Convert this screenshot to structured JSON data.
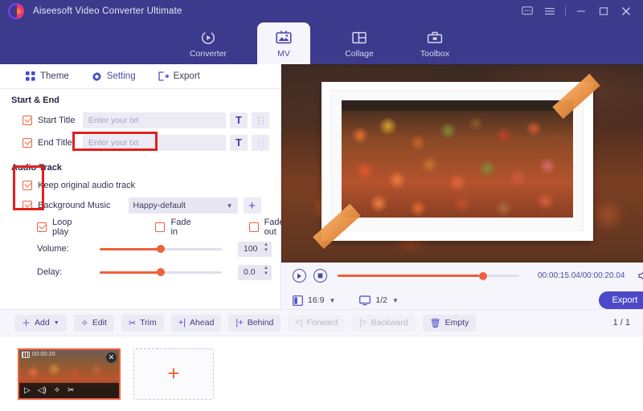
{
  "window": {
    "app_title": "Aiseesoft Video Converter Ultimate",
    "controls": [
      {
        "name": "feedback",
        "glyph": "chat-icon"
      },
      {
        "name": "menu",
        "glyph": "hamburger-icon"
      },
      {
        "name": "minimize",
        "glyph": "minimize-icon"
      },
      {
        "name": "maximize",
        "glyph": "maximize-icon"
      },
      {
        "name": "close",
        "glyph": "close-icon"
      }
    ]
  },
  "nav": {
    "items": [
      {
        "label": "Converter",
        "icon": "converter-icon",
        "active": false
      },
      {
        "label": "MV",
        "icon": "mv-icon",
        "active": true
      },
      {
        "label": "Collage",
        "icon": "collage-icon",
        "active": false
      },
      {
        "label": "Toolbox",
        "icon": "toolbox-icon",
        "active": false
      }
    ]
  },
  "subtabs": {
    "items": [
      {
        "label": "Theme",
        "icon": "grid-icon",
        "active": false
      },
      {
        "label": "Setting",
        "icon": "gear-icon",
        "active": true
      },
      {
        "label": "Export",
        "icon": "export-icon",
        "active": false
      }
    ]
  },
  "settings": {
    "start_end": {
      "section_label": "Start & End",
      "start_title": {
        "label": "Start Title",
        "checked": true,
        "value": "",
        "placeholder": "Enter your txt",
        "text_button": "T",
        "drag_button": "⣿"
      },
      "end_title": {
        "label": "End Title",
        "checked": true,
        "value": "",
        "placeholder": "Enter your txt",
        "text_button": "T",
        "drag_button": "⣿"
      }
    },
    "audio_track": {
      "section_label": "Audio Track",
      "keep_original": {
        "label": "Keep original audio track",
        "checked": true
      },
      "background_music": {
        "label": "Background Music",
        "checked": true,
        "selected": "Happy-default",
        "add_button": "+"
      },
      "loop_play": {
        "label": "Loop play",
        "checked": true
      },
      "fade_in": {
        "label": "Fade in",
        "checked": false
      },
      "fade_out": {
        "label": "Fade out",
        "checked": false
      },
      "volume": {
        "label": "Volume:",
        "value": "100",
        "percent": 50
      },
      "delay": {
        "label": "Delay:",
        "value": "0.0",
        "percent": 50
      }
    }
  },
  "preview": {
    "play_button": "play-icon",
    "stop_button": "stop-icon",
    "seek_percent": 78,
    "timecode": "00:00:15.04/00:00:20.04",
    "volume_icon": "speaker-icon",
    "aspect_ratio": "16:9",
    "zoom_level": "1/2",
    "export_label": "Export"
  },
  "toolbar": {
    "buttons": [
      {
        "label": "Add",
        "icon": "plus-icon",
        "disabled": false,
        "has_caret": true
      },
      {
        "label": "Edit",
        "icon": "wand-icon",
        "disabled": false,
        "has_caret": false
      },
      {
        "label": "Trim",
        "icon": "scissors-icon",
        "disabled": false,
        "has_caret": false
      },
      {
        "label": "Ahead",
        "icon": "insert-ahead-icon",
        "disabled": false,
        "has_caret": false
      },
      {
        "label": "Behind",
        "icon": "insert-behind-icon",
        "disabled": false,
        "has_caret": false
      },
      {
        "label": "Forward",
        "icon": "move-forward-icon",
        "disabled": true,
        "has_caret": false
      },
      {
        "label": "Backward",
        "icon": "move-backward-icon",
        "disabled": true,
        "has_caret": false
      },
      {
        "label": "Empty",
        "icon": "trash-icon",
        "disabled": false,
        "has_caret": false
      }
    ],
    "page_indicator": "1 / 1"
  },
  "storyboard": {
    "clip": {
      "duration": "00:00:20",
      "close_label": "✕",
      "tools": [
        "play-icon",
        "volume-icon",
        "effects-icon",
        "cut-icon"
      ]
    },
    "add_placeholder": "+"
  },
  "annotations": {
    "setting_tab_highlight": "#e02020",
    "checkbox_highlight": "#e02020"
  },
  "colors": {
    "brand_purple": "#3b3a8c",
    "accent_blue": "#4b49c8",
    "accent_orange": "#f0603a",
    "annotation_red": "#e02020"
  }
}
